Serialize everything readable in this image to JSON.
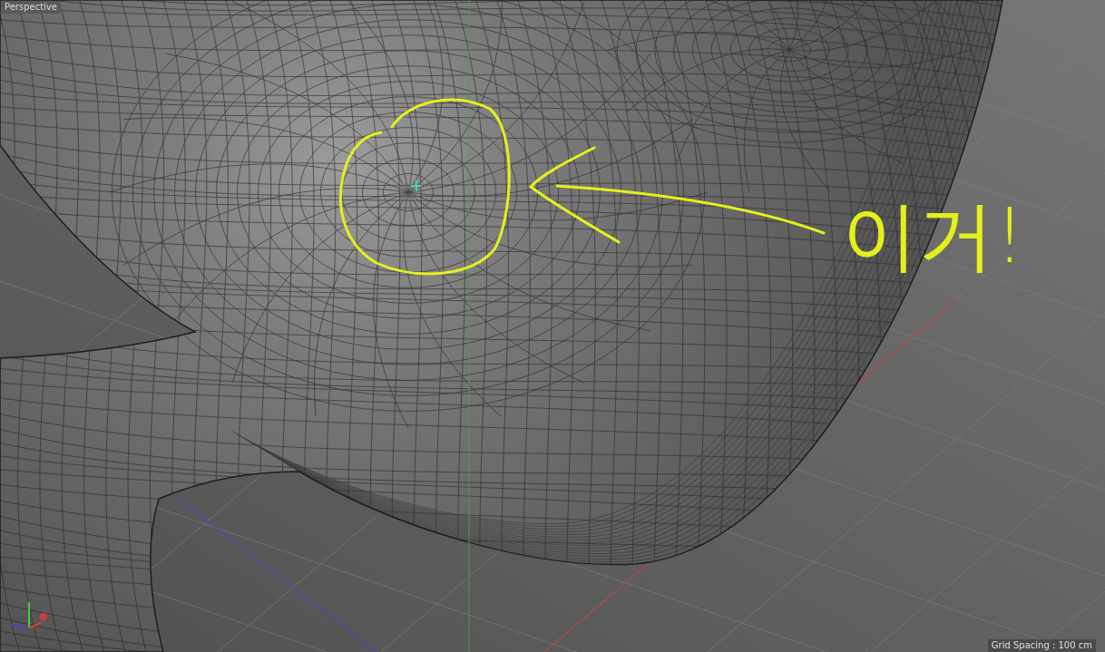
{
  "viewport": {
    "label": "Perspective",
    "grid_spacing": "Grid Spacing : 100 cm"
  },
  "annotation": {
    "text": "이거!"
  }
}
